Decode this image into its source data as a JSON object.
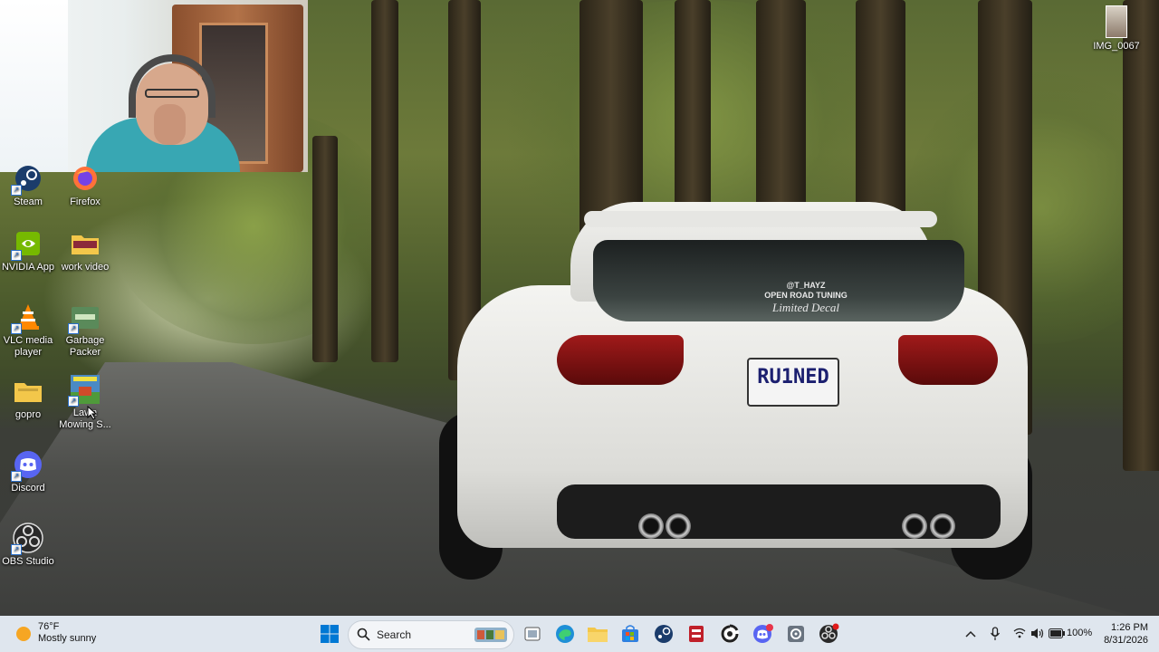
{
  "desktop": {
    "top_right_icon": {
      "label": "IMG_0067",
      "icon": "image-file-icon"
    },
    "icons": [
      {
        "label": "Steam",
        "icon": "steam-icon"
      },
      {
        "label": "Firefox",
        "icon": "firefox-icon"
      },
      {
        "label": "NVIDIA App",
        "icon": "nvidia-icon"
      },
      {
        "label": "work video",
        "icon": "folder-icon"
      },
      {
        "label": "VLC media player",
        "icon": "vlc-icon"
      },
      {
        "label": "Garbage Packer",
        "icon": "game-icon"
      },
      {
        "label": "gopro",
        "icon": "folder-icon"
      },
      {
        "label": "Lawn Mowing S...",
        "icon": "game-icon"
      },
      {
        "label": "Discord",
        "icon": "discord-icon"
      },
      {
        "label": "OBS Studio",
        "icon": "obs-icon"
      }
    ]
  },
  "wallpaper": {
    "plate_text": "RU1NED",
    "decal_line1": "@T_HAYZ",
    "decal_line2": "OPEN ROAD TUNING",
    "decal_line3": "Limited Decal"
  },
  "taskbar": {
    "weather_temp": "76°F",
    "weather_desc": "Mostly sunny",
    "search_label": "Search",
    "battery": "100%",
    "time": "1:26 PM",
    "date": "8/31/2026",
    "accent": "#0078d4",
    "pinned": [
      "widgets-icon",
      "task-view-icon",
      "edge-icon",
      "file-explorer-icon",
      "store-icon",
      "steam-icon",
      "game-icon",
      "chrome-icon",
      "discord-icon",
      "settings-icon",
      "obs-icon"
    ]
  }
}
